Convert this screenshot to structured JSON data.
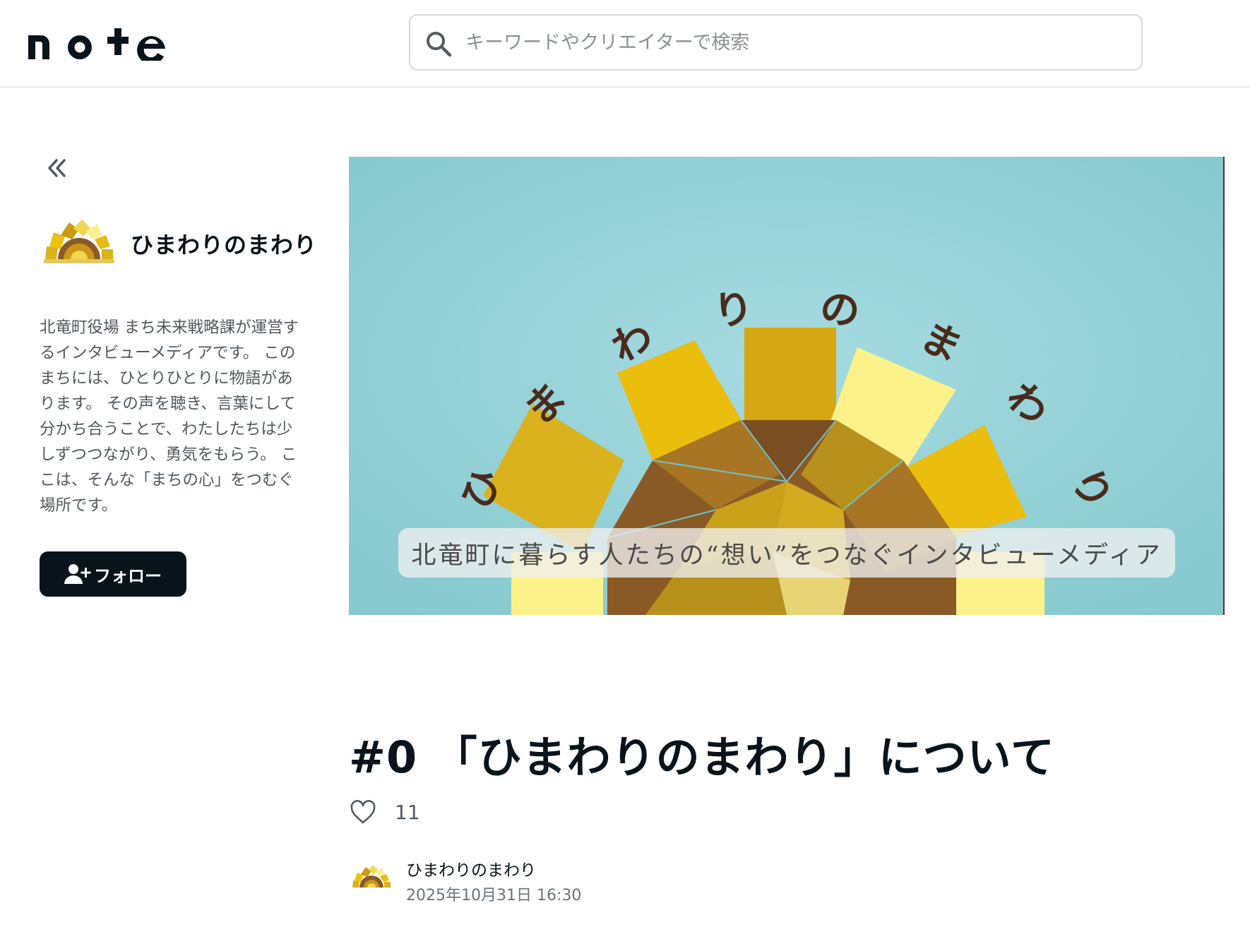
{
  "header": {
    "logo_text": "note",
    "search": {
      "placeholder": "キーワードやクリエイターで検索",
      "value": ""
    }
  },
  "sidebar": {
    "creator_name": "ひまわりのまわり",
    "description": "北竜町役場 まち未来戦略課が運営するインタビューメディアです。 このまちには、ひとりひとりに物語があります。 その声を聴き、言葉にして分かち合うことで、わたしたちは少しずつつながり、勇気をもらう。 ここは、そんな「まちの心」をつむぐ場所です。",
    "follow_label": "フォロー"
  },
  "hero": {
    "title_text": "ひまわりのまわり",
    "tagline": "北竜町に暮らす人たちの“想い”をつなぐインタビューメディア"
  },
  "article": {
    "title": "#0 「ひまわりのまわり」について",
    "likes": "11",
    "author": "ひまわりのまわり",
    "date": "2025年10月31日 16:30"
  },
  "colors": {
    "text_primary": "#08131a",
    "button_bg": "#08131a",
    "hero_bg": "#8fd0d6",
    "sunflower_gold": "#e8bb12",
    "sunflower_brown": "#8a5a26",
    "sunflower_light": "#fbf08e"
  },
  "icons": [
    "search-icon",
    "collapse-left-icon",
    "user-plus-icon",
    "heart-icon"
  ]
}
